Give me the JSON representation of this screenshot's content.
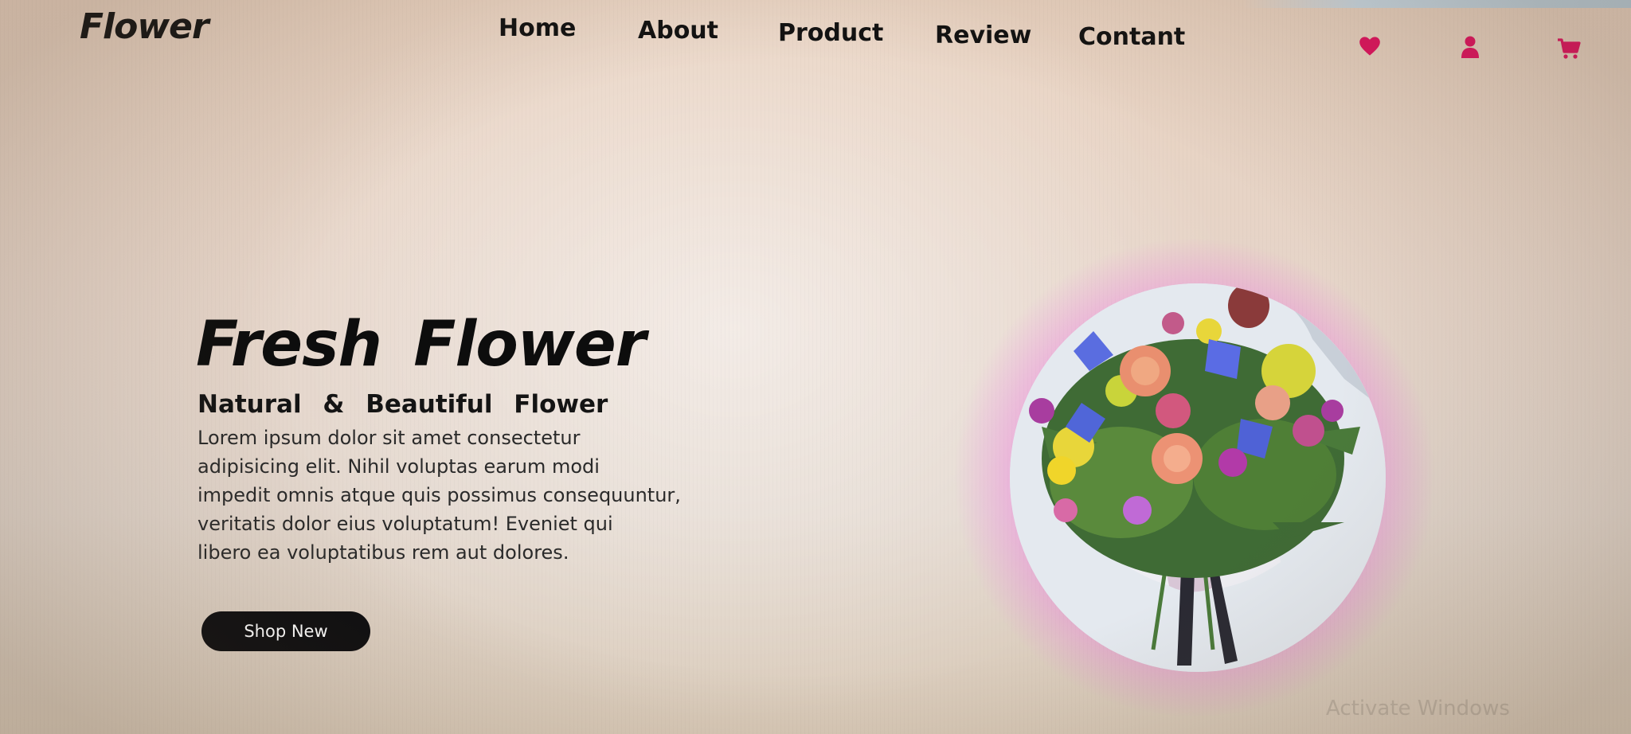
{
  "brand": {
    "logo_text": "Flower"
  },
  "nav": {
    "items": [
      {
        "label": "Home"
      },
      {
        "label": "About"
      },
      {
        "label": "Product"
      },
      {
        "label": "Review"
      },
      {
        "label": "Contant"
      }
    ]
  },
  "header_icons": [
    {
      "name": "heart-icon",
      "color": "#e0115f"
    },
    {
      "name": "user-icon",
      "color": "#e0115f"
    },
    {
      "name": "shopping-cart-icon",
      "color": "#e0115f"
    }
  ],
  "hero": {
    "title": "Fresh  Flower",
    "subtitle": "Natural  &  Beautiful  Flower",
    "description_lines": [
      "Lorem ipsum dolor sit amet consectetur",
      "adipisicing elit. Nihil voluptas earum modi",
      "impedit omnis atque quis possimus consequuntur,",
      "veritatis dolor eius voluptatum! Eveniet qui",
      "libero ea voluptatibus rem aut dolores."
    ],
    "button_label": "Shop New",
    "image_name": "flower-bouquet-image",
    "glow_color": "#f04ae6"
  },
  "os_watermark": "Activate Windows"
}
